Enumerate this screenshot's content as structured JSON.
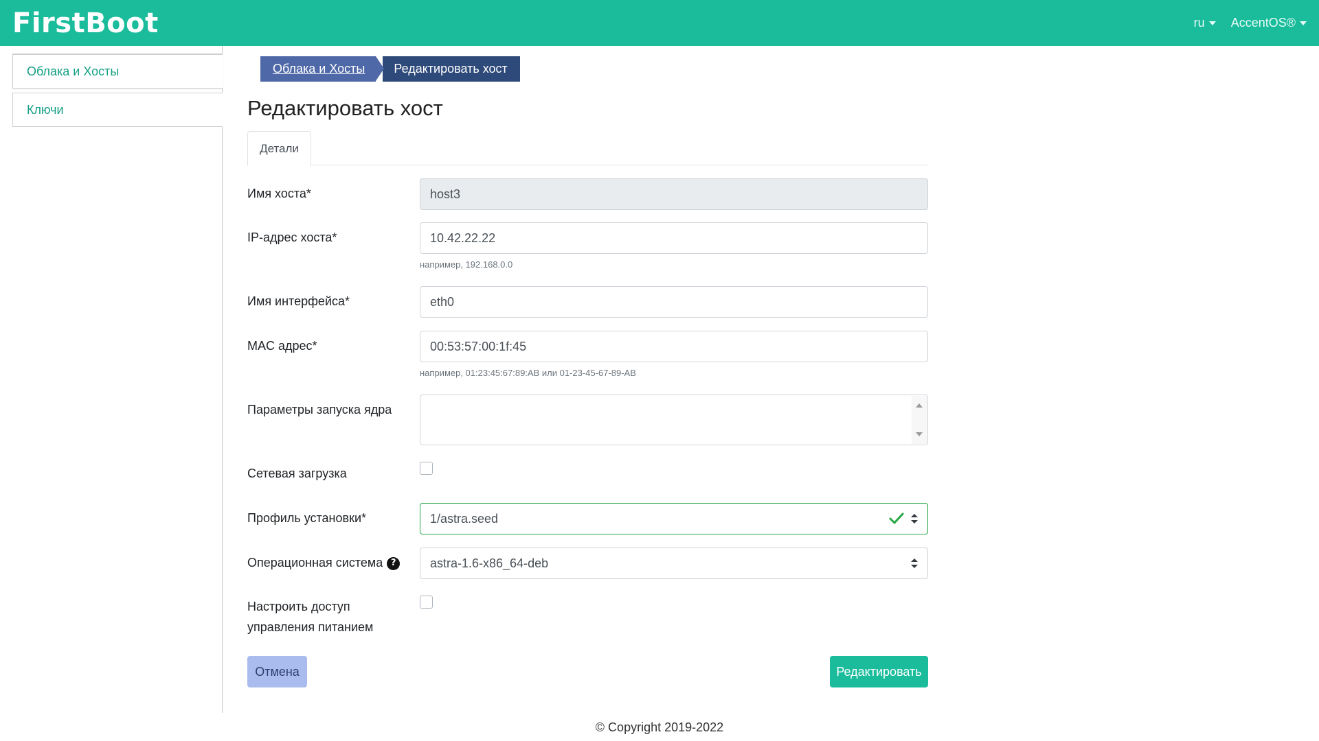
{
  "header": {
    "brand": "FirstBoot",
    "language": "ru",
    "user": "AccentOS®"
  },
  "sidebar": {
    "items": [
      {
        "label": "Облака и Хосты"
      },
      {
        "label": "Ключи"
      }
    ]
  },
  "breadcrumb": {
    "items": [
      "Облака и Хосты",
      "Редактировать хост"
    ]
  },
  "page": {
    "title": "Редактировать хост",
    "tab": "Детали"
  },
  "form": {
    "hostname": {
      "label": "Имя хоста*",
      "value": "host3"
    },
    "ip": {
      "label": "IP-адрес хоста*",
      "value": "10.42.22.22",
      "help": "например, 192.168.0.0"
    },
    "interface": {
      "label": "Имя интерфейса*",
      "value": "eth0"
    },
    "mac": {
      "label": "MAC адрес*",
      "value": "00:53:57:00:1f:45",
      "help": "например, 01:23:45:67:89:AB или 01-23-45-67-89-AB"
    },
    "kernel": {
      "label": "Параметры запуска ядра",
      "value": ""
    },
    "netboot": {
      "label": "Сетевая загрузка",
      "checked": false
    },
    "profile": {
      "label": "Профиль установки*",
      "value": "1/astra.seed"
    },
    "os": {
      "label": "Операционная система",
      "value": "astra-1.6-x86_64-deb"
    },
    "power": {
      "label": "Настроить доступ управления питанием",
      "checked": false
    }
  },
  "buttons": {
    "cancel": "Отмена",
    "submit": "Редактировать"
  },
  "footer": {
    "copyright": "© Copyright 2019-2022"
  },
  "colors": {
    "accent": "#1abc9c",
    "breadcrumb_primary": "#4f69a8",
    "breadcrumb_active": "#2e4a7a",
    "valid": "#28a745",
    "cancel_bg": "#aabbee"
  }
}
